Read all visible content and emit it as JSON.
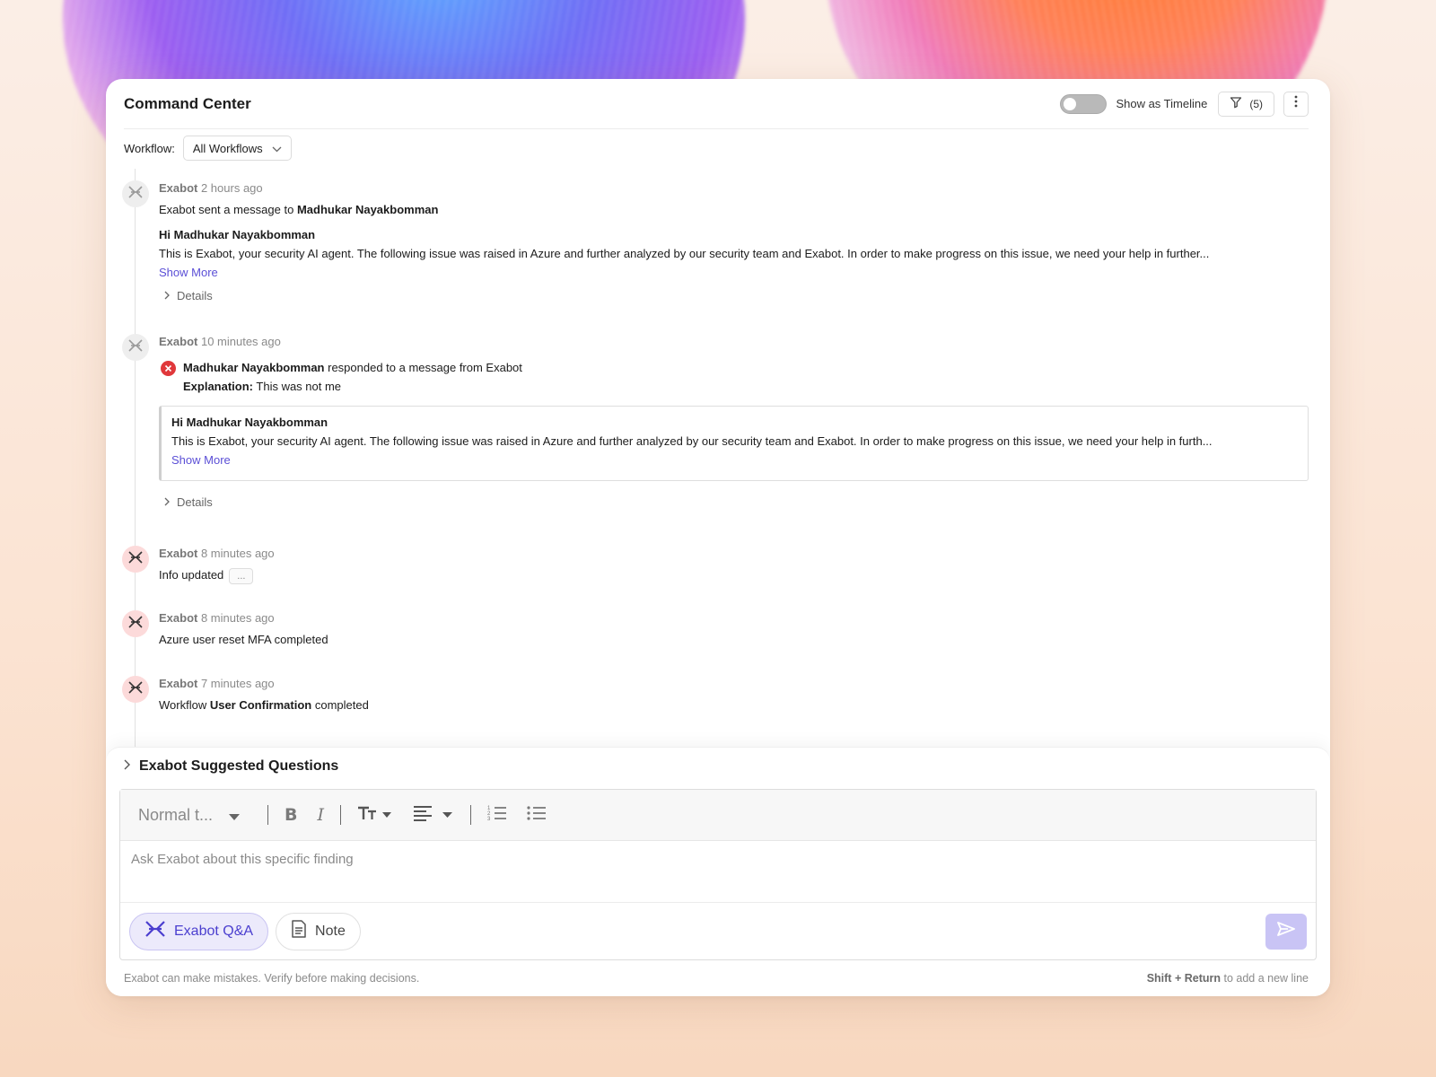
{
  "header": {
    "title": "Command Center",
    "toggle_label": "Show as Timeline",
    "toggle_on": false,
    "filter_count": "(5)"
  },
  "workflow": {
    "label": "Workflow:",
    "selected": "All Workflows"
  },
  "events": [
    {
      "actor": "Exabot",
      "time": "2 hours ago",
      "summary_prefix": "Exabot sent a message to ",
      "summary_bold": "Madhukar Nayakbomman",
      "message_title": "Hi Madhukar Nayakbomman",
      "message_body": "This is Exabot, your security AI agent. The following issue was raised in Azure and further analyzed by our security team and Exabot. In order to make progress on this issue, we need your help in further...",
      "show_more": "Show More",
      "details": "Details"
    },
    {
      "actor": "Exabot",
      "time": "10 minutes ago",
      "responder": "Madhukar Nayakbomman",
      "response_text": " responded to a message from Exabot",
      "explanation_label": "Explanation:",
      "explanation": " This was not me",
      "message_title": "Hi Madhukar Nayakbomman",
      "message_body": "This is Exabot, your security AI agent. The following issue was raised in Azure and further analyzed by our security team and Exabot. In order to make progress on this issue, we need your help in furth...",
      "show_more": "Show More",
      "details": "Details"
    },
    {
      "actor": "Exabot",
      "time": "8 minutes ago",
      "text": "Info updated",
      "chip": "..."
    },
    {
      "actor": "Exabot",
      "time": "8 minutes ago",
      "text": "Azure user reset MFA completed"
    },
    {
      "actor": "Exabot",
      "time": "7 minutes ago",
      "text_prefix": "Workflow ",
      "text_bold": "User Confirmation",
      "text_suffix": " completed"
    }
  ],
  "composer": {
    "suggested_label": "Exabot Suggested Questions",
    "text_style": "Normal t...",
    "placeholder": "Ask Exabot about this specific finding",
    "mode_qa": "Exabot Q&A",
    "mode_note": "Note",
    "disclaimer": "Exabot can make mistakes. Verify before making decisions.",
    "shortcut_keys": "Shift + Return",
    "shortcut_text": " to add a new line"
  },
  "colors": {
    "accent": "#5b4fd6",
    "error": "#e0383b",
    "send_button": "#c9c4f5"
  }
}
